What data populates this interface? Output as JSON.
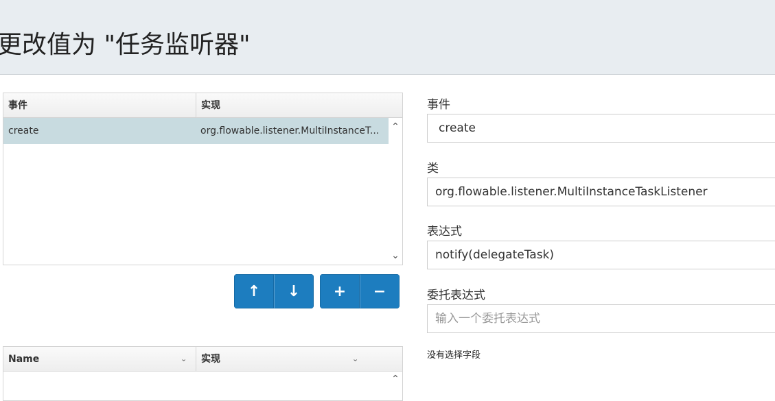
{
  "header": {
    "title": "更改值为 \"任务监听器\""
  },
  "listener_grid": {
    "columns": [
      "事件",
      "实现"
    ],
    "rows": [
      {
        "event": "create",
        "implementation": "org.flowable.listener.MultiInstanceT..."
      }
    ],
    "scroll_up": "⌃",
    "scroll_down": "⌄"
  },
  "toolbar": {
    "move_up": "↑",
    "move_down": "↓",
    "add": "+",
    "remove": "−"
  },
  "form": {
    "event_label": "事件",
    "event_value": "create",
    "class_label": "类",
    "class_value": "org.flowable.listener.MultiInstanceTaskListener",
    "expression_label": "表达式",
    "expression_value": "notify(delegateTask)",
    "delegate_label": "委托表达式",
    "delegate_placeholder": "输入一个委托表达式",
    "no_field_note": "没有选择字段"
  },
  "fields_grid": {
    "columns": [
      "Name",
      "实现"
    ],
    "chevron": "⌄",
    "scroll_up": "⌃"
  }
}
